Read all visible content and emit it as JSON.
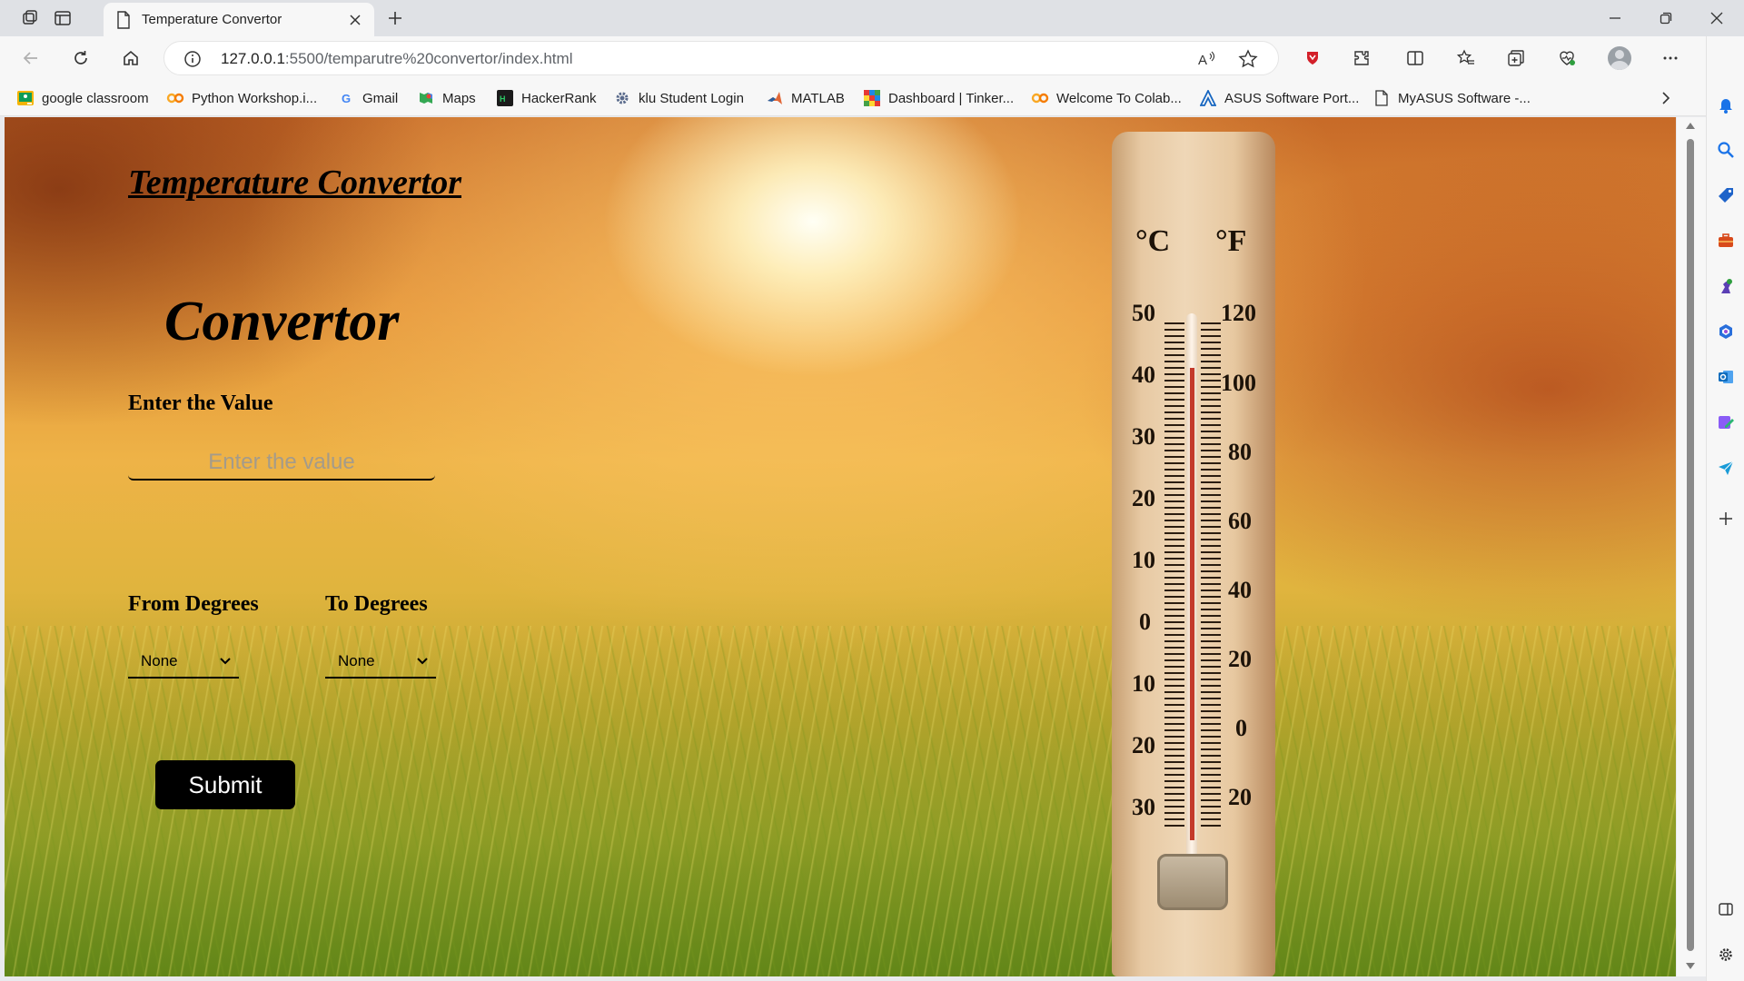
{
  "browser": {
    "tab_title": "Temperature Convertor",
    "url_host": "127.0.0.1",
    "url_rest": ":5500/temparutre%20convertor/index.html",
    "accent": "#0c5ed8"
  },
  "bookmarks": [
    {
      "label": "google classroom",
      "icon": "google-classroom-icon"
    },
    {
      "label": "Python Workshop.i...",
      "icon": "infinity-icon"
    },
    {
      "label": "Gmail",
      "icon": "google-icon"
    },
    {
      "label": "Maps",
      "icon": "maps-icon"
    },
    {
      "label": "HackerRank",
      "icon": "hackerrank-icon"
    },
    {
      "label": "klu Student Login",
      "icon": "gear-icon"
    },
    {
      "label": "MATLAB",
      "icon": "matlab-icon"
    },
    {
      "label": "Dashboard | Tinker...",
      "icon": "tinkercad-icon"
    },
    {
      "label": "Welcome To Colab...",
      "icon": "infinity-icon"
    },
    {
      "label": "ASUS Software Port...",
      "icon": "asus-icon"
    },
    {
      "label": "MyASUS Software -...",
      "icon": "page-icon"
    }
  ],
  "page": {
    "heading": "Temperature Convertor",
    "form_title": "Convertor",
    "value_label": "Enter the Value",
    "value_placeholder": "Enter the value",
    "from_label": "From Degrees",
    "to_label": "To Degrees",
    "from_selected": "None",
    "to_selected": "None",
    "submit_label": "Submit"
  },
  "thermometer": {
    "celsius_mark": "°C",
    "fahrenheit_mark": "°F",
    "celsius_ticks": [
      "50",
      "40",
      "30",
      "20",
      "10",
      "0",
      "10",
      "20",
      "30"
    ],
    "fahrenheit_ticks": [
      "120",
      "100",
      "80",
      "60",
      "40",
      "20",
      "0",
      "20"
    ]
  }
}
